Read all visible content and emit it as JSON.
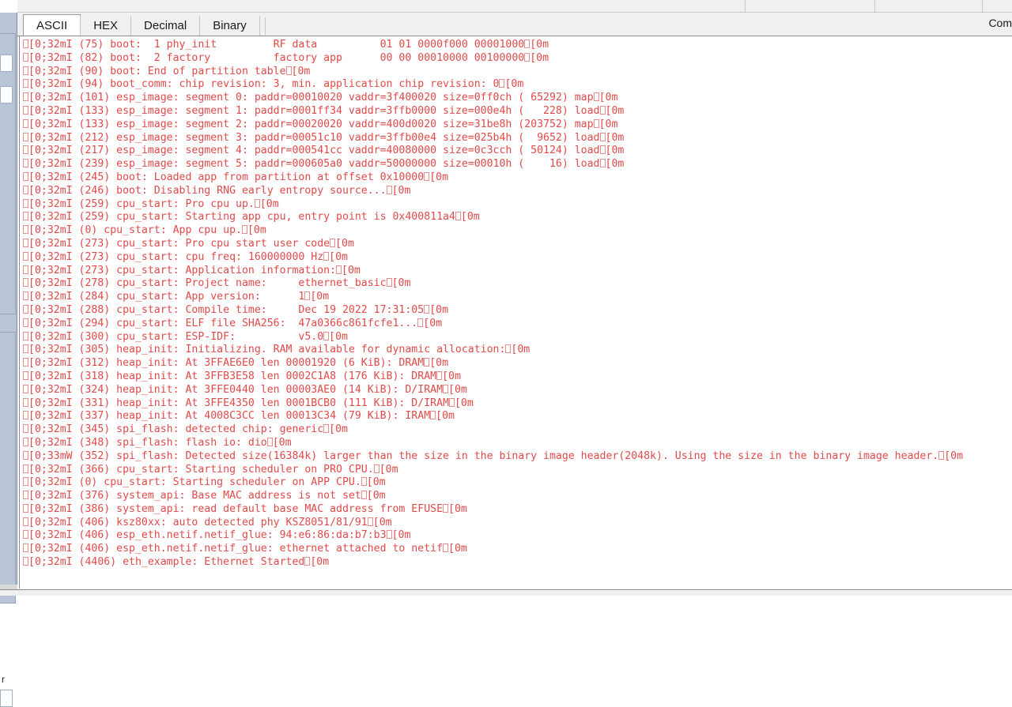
{
  "window": {
    "right_header_label": "Com"
  },
  "left_dock": {
    "collapse_icon": "chevron-left-icon",
    "collapse_glyph": "‹",
    "caption": "r"
  },
  "tabs": {
    "items": [
      {
        "label": "ASCII",
        "selected": true
      },
      {
        "label": "HEX",
        "selected": false
      },
      {
        "label": "Decimal",
        "selected": false
      },
      {
        "label": "Binary",
        "selected": false
      }
    ]
  },
  "console": {
    "esc_prefix": "[0;32mI",
    "esc_prefix_warn": "[0;33mW",
    "esc_suffix": "[0m",
    "text_color": "#e04a4a",
    "lines": [
      "[0;32mI (75) boot:  1 phy_init         RF data          01 01 0000f000 00001000[0m",
      "[0;32mI (82) boot:  2 factory          factory app      00 00 00010000 00100000[0m",
      "[0;32mI (90) boot: End of partition table[0m",
      "[0;32mI (94) boot_comm: chip revision: 3, min. application chip revision: 0[0m",
      "[0;32mI (101) esp_image: segment 0: paddr=00010020 vaddr=3f400020 size=0ff0ch ( 65292) map[0m",
      "[0;32mI (133) esp_image: segment 1: paddr=0001ff34 vaddr=3ffb0000 size=000e4h (   228) load[0m",
      "[0;32mI (133) esp_image: segment 2: paddr=00020020 vaddr=400d0020 size=31be8h (203752) map[0m",
      "[0;32mI (212) esp_image: segment 3: paddr=00051c10 vaddr=3ffb00e4 size=025b4h (  9652) load[0m",
      "[0;32mI (217) esp_image: segment 4: paddr=000541cc vaddr=40080000 size=0c3cch ( 50124) load[0m",
      "[0;32mI (239) esp_image: segment 5: paddr=000605a0 vaddr=50000000 size=00010h (    16) load[0m",
      "[0;32mI (245) boot: Loaded app from partition at offset 0x10000[0m",
      "[0;32mI (246) boot: Disabling RNG early entropy source...[0m",
      "[0;32mI (259) cpu_start: Pro cpu up.[0m",
      "[0;32mI (259) cpu_start: Starting app cpu, entry point is 0x400811a4[0m",
      "[0;32mI (0) cpu_start: App cpu up.[0m",
      "[0;32mI (273) cpu_start: Pro cpu start user code[0m",
      "[0;32mI (273) cpu_start: cpu freq: 160000000 Hz[0m",
      "[0;32mI (273) cpu_start: Application information:[0m",
      "[0;32mI (278) cpu_start: Project name:     ethernet_basic[0m",
      "[0;32mI (284) cpu_start: App version:      1[0m",
      "[0;32mI (288) cpu_start: Compile time:     Dec 19 2022 17:31:05[0m",
      "[0;32mI (294) cpu_start: ELF file SHA256:  47a0366c861fcfe1...[0m",
      "[0;32mI (300) cpu_start: ESP-IDF:          v5.0[0m",
      "[0;32mI (305) heap_init: Initializing. RAM available for dynamic allocation:[0m",
      "[0;32mI (312) heap_init: At 3FFAE6E0 len 00001920 (6 KiB): DRAM[0m",
      "[0;32mI (318) heap_init: At 3FFB3E58 len 0002C1A8 (176 KiB): DRAM[0m",
      "[0;32mI (324) heap_init: At 3FFE0440 len 00003AE0 (14 KiB): D/IRAM[0m",
      "[0;32mI (331) heap_init: At 3FFE4350 len 0001BCB0 (111 KiB): D/IRAM[0m",
      "[0;32mI (337) heap_init: At 4008C3CC len 00013C34 (79 KiB): IRAM[0m",
      "[0;32mI (345) spi_flash: detected chip: generic[0m",
      "[0;32mI (348) spi_flash: flash io: dio[0m",
      "[0;33mW (352) spi_flash: Detected size(16384k) larger than the size in the binary image header(2048k). Using the size in the binary image header.[0m",
      "[0;32mI (366) cpu_start: Starting scheduler on PRO CPU.[0m",
      "[0;32mI (0) cpu_start: Starting scheduler on APP CPU.[0m",
      "[0;32mI (376) system_api: Base MAC address is not set[0m",
      "[0;32mI (386) system_api: read default base MAC address from EFUSE[0m",
      "[0;32mI (406) ksz80xx: auto detected phy KSZ8051/81/91[0m",
      "[0;32mI (406) esp_eth.netif.netif_glue: 94:e6:86:da:b7:b3[0m",
      "[0;32mI (406) esp_eth.netif.netif_glue: ethernet attached to netif[0m",
      "[0;32mI (4406) eth_example: Ethernet Started[0m"
    ]
  }
}
